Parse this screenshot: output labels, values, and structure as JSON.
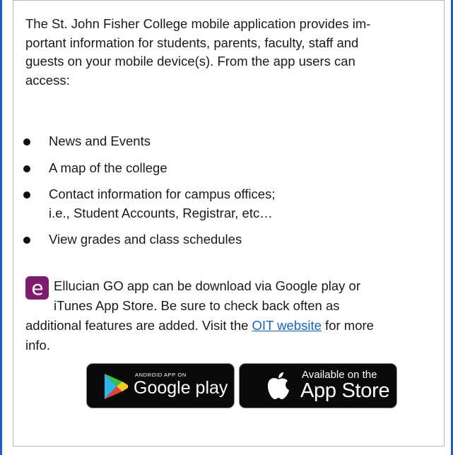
{
  "intro": {
    "line1": "The St. John Fisher College mobile application provides im-",
    "line2": "portant information for students, parents, faculty, staff and",
    "line3": "guests on your mobile device(s). From the app users can",
    "line4": "access:"
  },
  "features": [
    {
      "label": "News and Events"
    },
    {
      "label": "A map of the college"
    },
    {
      "label": "Contact information for campus offices;",
      "sub": "i.e., Student Accounts, Registrar, etc…"
    },
    {
      "label": "View grades and class schedules"
    }
  ],
  "app_info": {
    "line1": "Ellucian GO app can be download via Google play or",
    "line2": "iTunes App Store. Be sure to check back often as",
    "line3_before": "additional features are added.   Visit the ",
    "link_text": "OIT website",
    "line3_after": " for more",
    "line4": "info.",
    "icon_letter": "e"
  },
  "badges": {
    "google_top": "ANDROID APP ON",
    "google_main": "Google play",
    "apple_top": "Available on the",
    "apple_main": "App Store"
  },
  "colors": {
    "frame_blue": "#1f5fbf",
    "link_blue": "#1463c9",
    "app_icon": "#7e1d6e"
  }
}
